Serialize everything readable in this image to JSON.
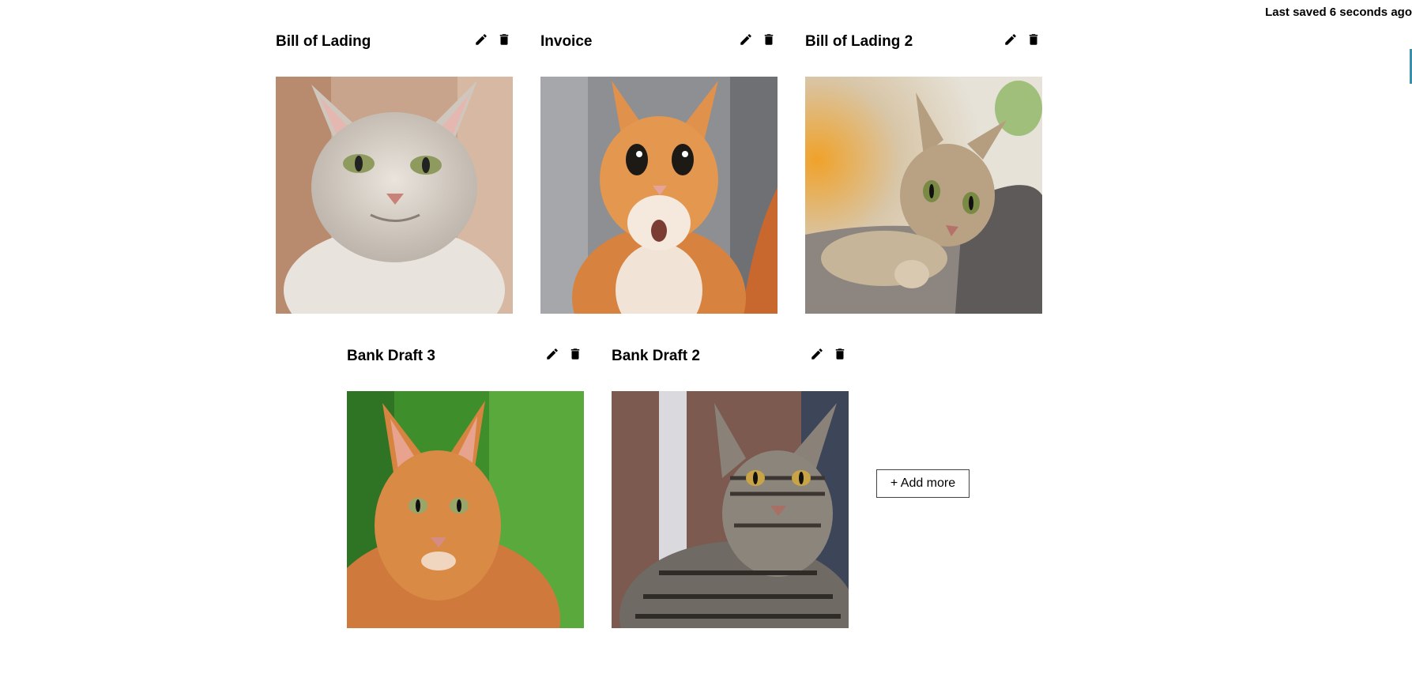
{
  "status": {
    "last_saved": "Last saved 6 seconds ago"
  },
  "documents": [
    {
      "title": "Bill of Lading",
      "image": "light gray tabby cat, warm background"
    },
    {
      "title": "Invoice",
      "image": "surprised orange cat, gray background"
    },
    {
      "title": "Bill of Lading 2",
      "image": "tabby cat lying on knit blanket, sunlight"
    },
    {
      "title": "Bank Draft 3",
      "image": "orange tabby cat, green background"
    },
    {
      "title": "Bank Draft 2",
      "image": "striped gray tabby cat, blurred background"
    }
  ],
  "icons": {
    "edit": "pencil-icon",
    "delete": "trash-icon"
  },
  "actions": {
    "add_more_label": "+ Add more"
  }
}
